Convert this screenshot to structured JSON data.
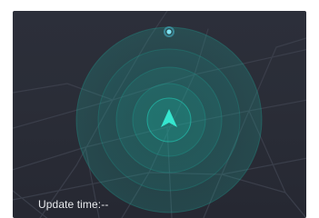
{
  "map": {
    "update_label": "Update time:--",
    "colors": {
      "background": "#2a2d37",
      "street_line": "#3c404c",
      "radar_ring": "#1fb5a5",
      "radar_glow": "#23d3bd",
      "location_arrow": "#36e6cf",
      "satellite_dot": "#4fd0e8"
    },
    "icons": {
      "location_arrow": "navigation-arrow-icon",
      "satellite_dot": "target-dot-icon"
    }
  }
}
